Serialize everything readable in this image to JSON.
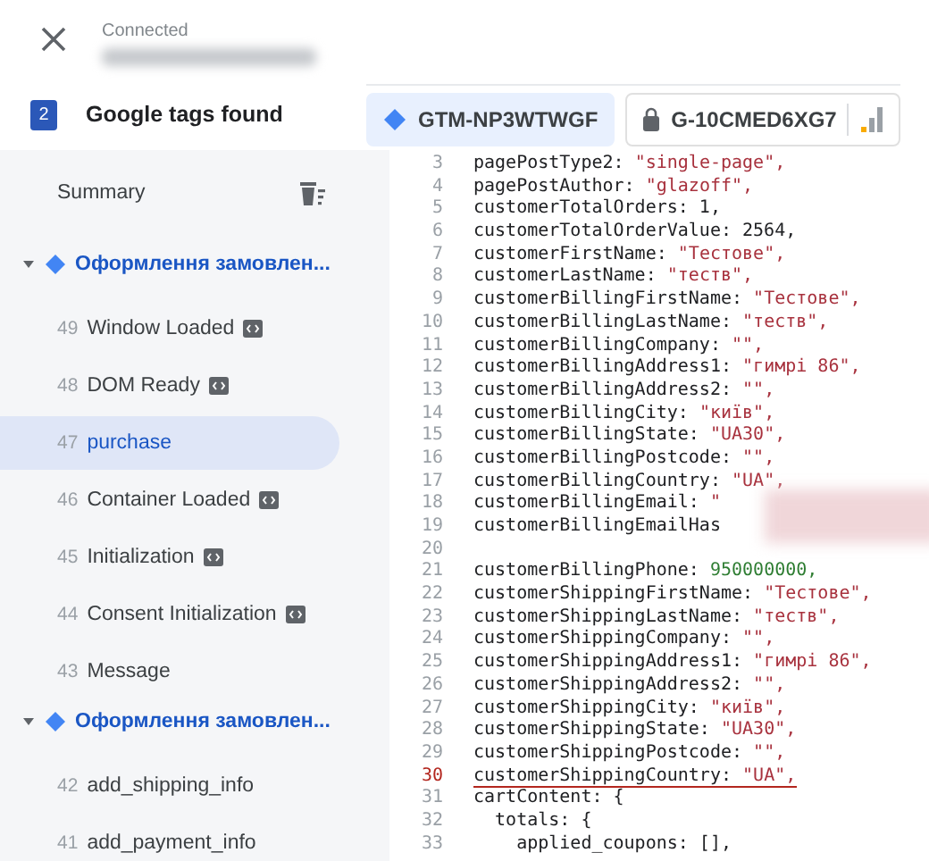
{
  "header": {
    "status": "Connected",
    "tag_count": "2",
    "tags_label": "Google tags found"
  },
  "tags": [
    {
      "label": "GTM-NP3WTWGF",
      "kind": "gtm",
      "selected": true
    },
    {
      "label": "G-10CMED6XG7",
      "kind": "ga",
      "selected": false
    }
  ],
  "sidebar": {
    "summary": "Summary",
    "groups": [
      {
        "title": "Оформлення замовлен...",
        "expanded": true,
        "items": [
          {
            "num": "49",
            "label": "Window Loaded",
            "has_badge": true,
            "selected": false
          },
          {
            "num": "48",
            "label": "DOM Ready",
            "has_badge": true,
            "selected": false
          },
          {
            "num": "47",
            "label": "purchase",
            "has_badge": false,
            "selected": true
          },
          {
            "num": "46",
            "label": "Container Loaded",
            "has_badge": true,
            "selected": false
          },
          {
            "num": "45",
            "label": "Initialization",
            "has_badge": true,
            "selected": false
          },
          {
            "num": "44",
            "label": "Consent Initialization",
            "has_badge": true,
            "selected": false
          },
          {
            "num": "43",
            "label": "Message",
            "has_badge": false,
            "selected": false
          }
        ]
      },
      {
        "title": "Оформлення замовлен...",
        "expanded": true,
        "items": [
          {
            "num": "42",
            "label": "add_shipping_info",
            "has_badge": false,
            "selected": false
          },
          {
            "num": "41",
            "label": "add_payment_info",
            "has_badge": false,
            "selected": false
          }
        ]
      }
    ]
  },
  "code": {
    "lines": [
      {
        "num": "3",
        "code": "pagePostType2:",
        "value": "\"single-page\",",
        "kind": "string",
        "underlined": false
      },
      {
        "num": "4",
        "code": "pagePostAuthor:",
        "value": "\"glazoff\",",
        "kind": "string",
        "underlined": false
      },
      {
        "num": "5",
        "code": "customerTotalOrders: 1,",
        "kind": "plain",
        "underlined": false
      },
      {
        "num": "6",
        "code": "customerTotalOrderValue: 2564,",
        "kind": "plain",
        "underlined": false
      },
      {
        "num": "7",
        "code": "customerFirstName:",
        "value": "\"Тестове\",",
        "kind": "string",
        "underlined": false
      },
      {
        "num": "8",
        "code": "customerLastName:",
        "value": "\"теств\",",
        "kind": "string",
        "underlined": false
      },
      {
        "num": "9",
        "code": "customerBillingFirstName:",
        "value": "\"Тестове\",",
        "kind": "string",
        "underlined": false
      },
      {
        "num": "10",
        "code": "customerBillingLastName:",
        "value": "\"теств\",",
        "kind": "string",
        "underlined": false
      },
      {
        "num": "11",
        "code": "customerBillingCompany:",
        "value": "\"\",",
        "kind": "string",
        "underlined": false
      },
      {
        "num": "12",
        "code": "customerBillingAddress1:",
        "value": "\"гимрі 86\",",
        "kind": "string",
        "underlined": false
      },
      {
        "num": "13",
        "code": "customerBillingAddress2:",
        "value": "\"\",",
        "kind": "string",
        "underlined": false
      },
      {
        "num": "14",
        "code": "customerBillingCity:",
        "value": "\"київ\",",
        "kind": "string",
        "underlined": false
      },
      {
        "num": "15",
        "code": "customerBillingState:",
        "value": "\"UA30\",",
        "kind": "string",
        "underlined": false
      },
      {
        "num": "16",
        "code": "customerBillingPostcode:",
        "value": "\"\",",
        "kind": "string",
        "underlined": false
      },
      {
        "num": "17",
        "code": "customerBillingCountry:",
        "value": "\"UA\",",
        "kind": "string",
        "underlined": false
      },
      {
        "num": "18",
        "code": "customerBillingEmail:",
        "value": "\"",
        "kind": "string",
        "underlined": false
      },
      {
        "num": "19",
        "code": "customerBillingEmailHas",
        "kind": "plain",
        "underlined": false
      },
      {
        "num": "20",
        "kind": "blank",
        "underlined": false
      },
      {
        "num": "21",
        "code": "customerBillingPhone:",
        "value": "950000000,",
        "kind": "number",
        "underlined": false
      },
      {
        "num": "22",
        "code": "customerShippingFirstName:",
        "value": "\"Тестове\",",
        "kind": "string",
        "underlined": false
      },
      {
        "num": "23",
        "code": "customerShippingLastName:",
        "value": "\"теств\",",
        "kind": "string",
        "underlined": false
      },
      {
        "num": "24",
        "code": "customerShippingCompany:",
        "value": "\"\",",
        "kind": "string",
        "underlined": false
      },
      {
        "num": "25",
        "code": "customerShippingAddress1:",
        "value": "\"гимрі 86\",",
        "kind": "string",
        "underlined": false
      },
      {
        "num": "26",
        "code": "customerShippingAddress2:",
        "value": "\"\",",
        "kind": "string",
        "underlined": false
      },
      {
        "num": "27",
        "code": "customerShippingCity:",
        "value": "\"київ\",",
        "kind": "string",
        "underlined": false
      },
      {
        "num": "28",
        "code": "customerShippingState:",
        "value": "\"UA30\",",
        "kind": "string",
        "underlined": false
      },
      {
        "num": "29",
        "code": "customerShippingPostcode:",
        "value": "\"\",",
        "kind": "string",
        "underlined": false
      },
      {
        "num": "30",
        "code": "customerShippingCountry:",
        "value": "\"UA\",",
        "kind": "string",
        "underlined": true
      },
      {
        "num": "31",
        "code": "cartContent: {",
        "kind": "plain",
        "underlined": false
      },
      {
        "num": "32",
        "code": "  totals: {",
        "kind": "plain",
        "underlined": false
      },
      {
        "num": "33",
        "code": "    applied_coupons: [],",
        "kind": "plain",
        "underlined": false
      }
    ]
  }
}
